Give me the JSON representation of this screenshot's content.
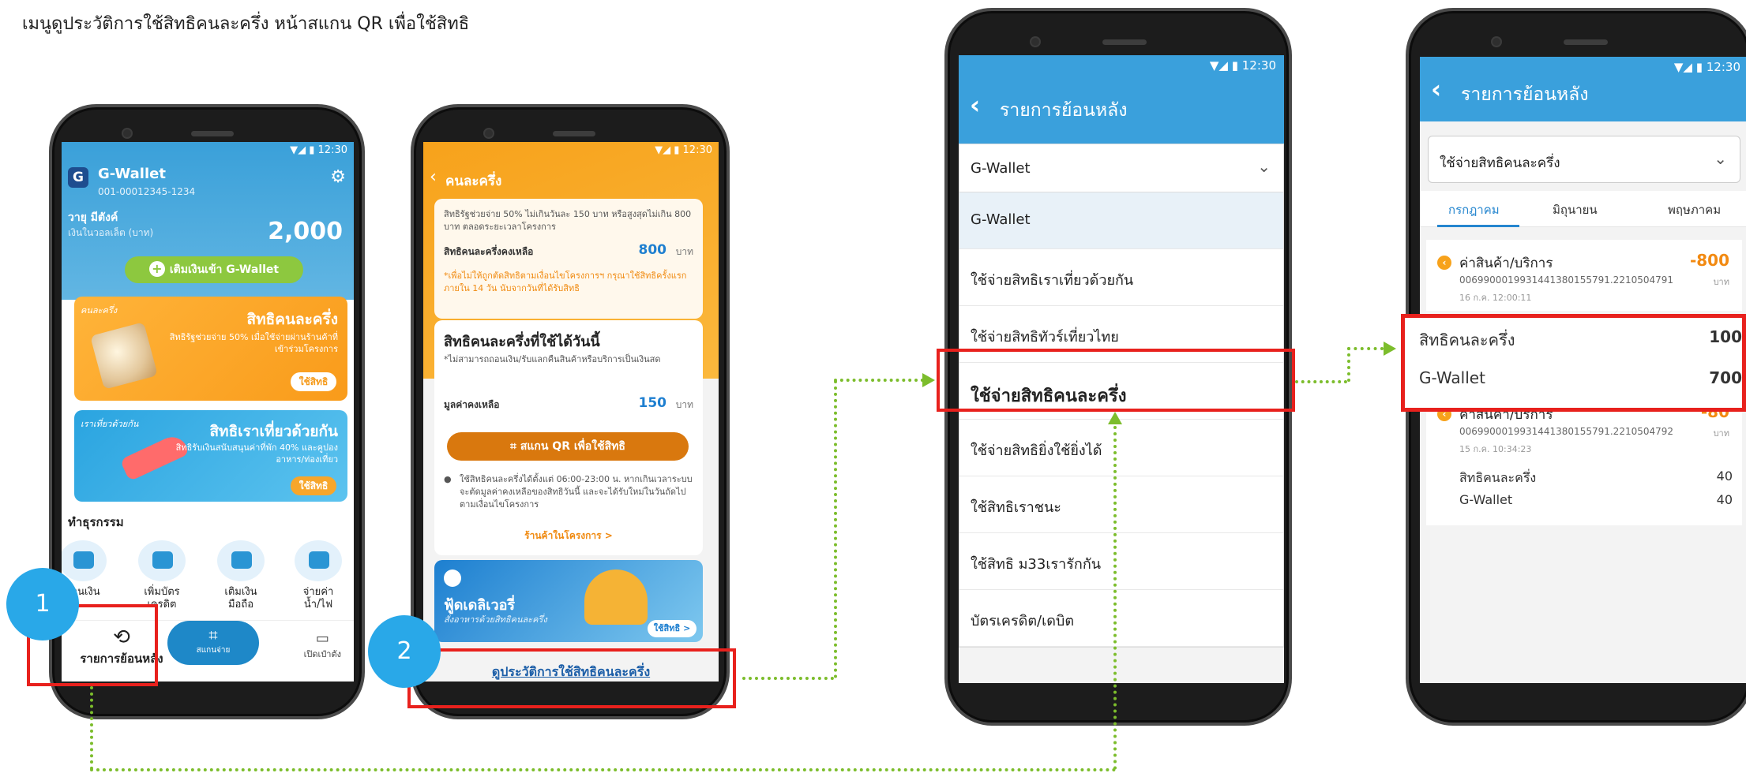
{
  "caption": "เมนูดูประวัติการใช้สิทธิคนละครึ่ง หน้าสแกน QR เพื่อใช้สิทธิ",
  "status_time": "12:30",
  "phone1": {
    "app_name": "G-Wallet",
    "account_no": "001-00012345-1234",
    "user_name": "วายุ มีตังค์",
    "balance_label": "เงินในวอลเล็ต (บาท)",
    "balance": "2,000",
    "topup_label": "เติมเงินเข้า G-Wallet",
    "banner1": {
      "tag": "คนละครึ่ง",
      "title": "สิทธิคนละครึ่ง",
      "sub": "สิทธิรัฐช่วยจ่าย 50% เมื่อใช้จ่ายผ่านร้านค้าที่เข้าร่วมโครงการ",
      "button": "ใช้สิทธิ"
    },
    "banner2": {
      "tag": "เราเที่ยวด้วยกัน",
      "title": "สิทธิเราเที่ยวด้วยกัน",
      "sub": "สิทธิรับเงินสนับสนุนค่าที่พัก 40% และคูปองอาหาร/ท่องเที่ยว",
      "button": "ใช้สิทธิ"
    },
    "section_title": "ทำธุรกรรม",
    "menu": [
      "โอนเงิน",
      "เพิ่มบัตร\nเครดิต",
      "เติมเงิน\nมือถือ",
      "จ่ายค่า\nน้ำ/ไฟ"
    ],
    "nav_history": "รายการย้อนหลัง",
    "nav_scan": "สแกนจ่าย",
    "nav_wallet": "เปิดเป๋าตัง",
    "badge": "1"
  },
  "phone2": {
    "title": "คนละครึ่ง",
    "info": "สิทธิรัฐช่วยจ่าย 50% ไม่เกินวันละ 150 บาท หรือสูงสุดไม่เกิน 800 บาท ตลอดระยะเวลาโครงการ",
    "remaining_label": "สิทธิคนละครึ่งคงเหลือ",
    "remaining_value": "800",
    "unit": "บาท",
    "warning": "*เพื่อไม่ให้ถูกตัดสิทธิตามเงื่อนไขโครงการฯ กรุณาใช้สิทธิครั้งแรก ภายใน 14 วัน นับจากวันที่ได้รับสิทธิ",
    "today_title": "สิทธิคนละครึ่งที่ใช้ได้วันนี้",
    "today_note": "*ไม่สามารถถอนเงิน/รับแลกคืนสินค้าหรือบริการเป็นเงินสด",
    "value_label": "มูลค่าคงเหลือ",
    "value": "150",
    "scan_button": "สแกน QR เพื่อใช้สิทธิ",
    "time_note": "ใช้สิทธิคนละครึ่งได้ตั้งแต่ 06:00-23:00 น. หากเกินเวลาระบบจะตัดมูลค่าคงเหลือของสิทธิวันนี้ และจะได้รับใหม่ในวันถัดไปตามเงื่อนไขโครงการ",
    "shops_link": "ร้านค้าในโครงการ >",
    "delivery_title": "ฟู้ดเดลิเวอรี่",
    "delivery_sub": "สั่งอาหารด้วยสิทธิคนละครึ่ง",
    "delivery_button": "ใช้สิทธิ >",
    "history_link": "ดูประวัติการใช้สิทธิคนละครึ่ง",
    "badge": "2"
  },
  "phone3": {
    "title": "รายการย้อนหลัง",
    "selected": "G-Wallet",
    "options": [
      "G-Wallet",
      "ใช้จ่ายสิทธิเราเที่ยวด้วยกัน",
      "ใช้จ่ายสิทธิทัวร์เที่ยวไทย",
      "ใช้จ่ายสิทธิคนละครึ่ง",
      "ใช้จ่ายสิทธิยิ่งใช้ยิ่งได้",
      "ใช้สิทธิเราชนะ",
      "ใช้สิทธิ ม33เรารักกัน",
      "บัตรเครดิต/เดบิต"
    ]
  },
  "phone4": {
    "title": "รายการย้อนหลัง",
    "selected": "ใช้จ่ายสิทธิคนละครึ่ง",
    "tabs": [
      "กรกฎาคม",
      "มิถุนายน",
      "พฤษภาคม"
    ],
    "txn1": {
      "name": "ค่าสินค้า/บริการ",
      "ref": "0069900019931441380155791.2210504791",
      "date": "16 ก.ค. 12:00:11",
      "amount": "-800",
      "currency": "บาท",
      "breakdown": [
        {
          "label": "สิทธิคนละครึ่ง",
          "value": "100"
        },
        {
          "label": "G-Wallet",
          "value": "700"
        }
      ]
    },
    "txn2": {
      "name": "ค่าสินค้า/บริการ",
      "ref": "0069900019931441380155791.2210504792",
      "date": "15 ก.ค. 10:34:23",
      "amount": "-80",
      "currency": "บาท",
      "breakdown": [
        {
          "label": "สิทธิคนละครึ่ง",
          "value": "40"
        },
        {
          "label": "G-Wallet",
          "value": "40"
        }
      ]
    }
  },
  "colors": {
    "highlight_red": "#e8211d",
    "connector_green": "#7cbd2c",
    "badge_blue": "#29a8e8",
    "app_blue": "#3aa0dc",
    "accent_orange": "#f7a21b"
  }
}
